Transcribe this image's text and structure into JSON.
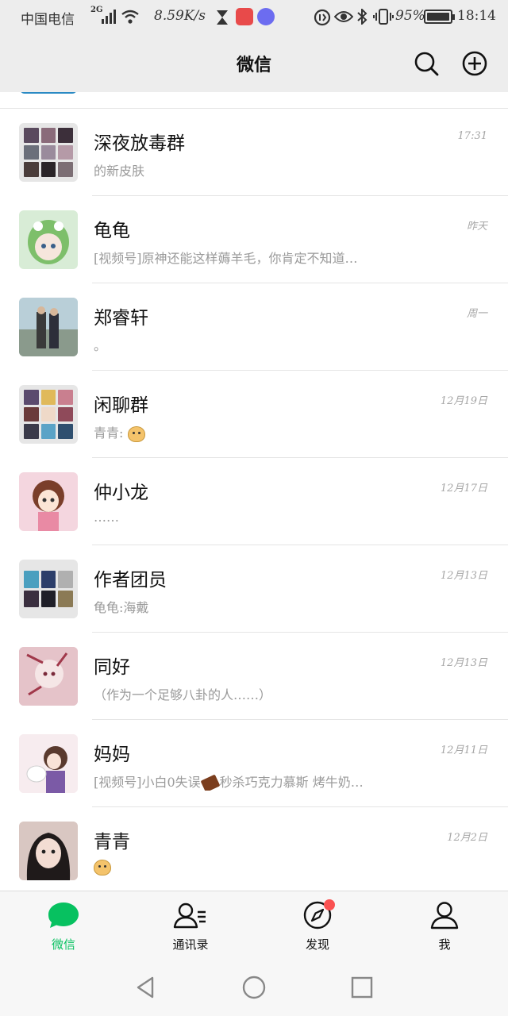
{
  "status_bar": {
    "carrier": "中国电信",
    "network": "2G",
    "speed": "8.59K/s",
    "battery": "95%",
    "time": "18:14"
  },
  "header": {
    "title": "微信",
    "search_icon": "search-icon",
    "add_icon": "plus-circle-icon"
  },
  "chats": [
    {
      "name": "深夜放毒群",
      "preview": "的新皮肤",
      "time": "17:31"
    },
    {
      "name": "龟龟",
      "preview": "[视频号]原神还能这样薅羊毛，你肯定不知道…",
      "time": "昨天"
    },
    {
      "name": "郑睿轩",
      "preview": "。",
      "time": "周一"
    },
    {
      "name": "闲聊群",
      "preview": "青青:",
      "time": "12月19日"
    },
    {
      "name": "仲小龙",
      "preview": "……",
      "time": "12月17日"
    },
    {
      "name": "作者团员",
      "preview": "龟龟:海戴",
      "time": "12月13日"
    },
    {
      "name": "同好",
      "preview": "（作为一个足够八卦的人……）",
      "time": "12月13日"
    },
    {
      "name": "妈妈",
      "preview_before": "[视频号]小白0失误",
      "preview_after": "秒杀巧克力慕斯 烤牛奶…",
      "time": "12月11日"
    },
    {
      "name": "青青",
      "preview": "",
      "time": "12月2日"
    }
  ],
  "tabs": [
    {
      "label": "微信",
      "icon": "chat-bubble-icon",
      "active": true
    },
    {
      "label": "通讯录",
      "icon": "contacts-icon",
      "active": false
    },
    {
      "label": "发现",
      "icon": "compass-icon",
      "active": false
    },
    {
      "label": "我",
      "icon": "person-icon",
      "active": false
    }
  ],
  "colors": {
    "accent": "#07c160",
    "badge": "#fa5151",
    "header_bg": "#ededed"
  }
}
